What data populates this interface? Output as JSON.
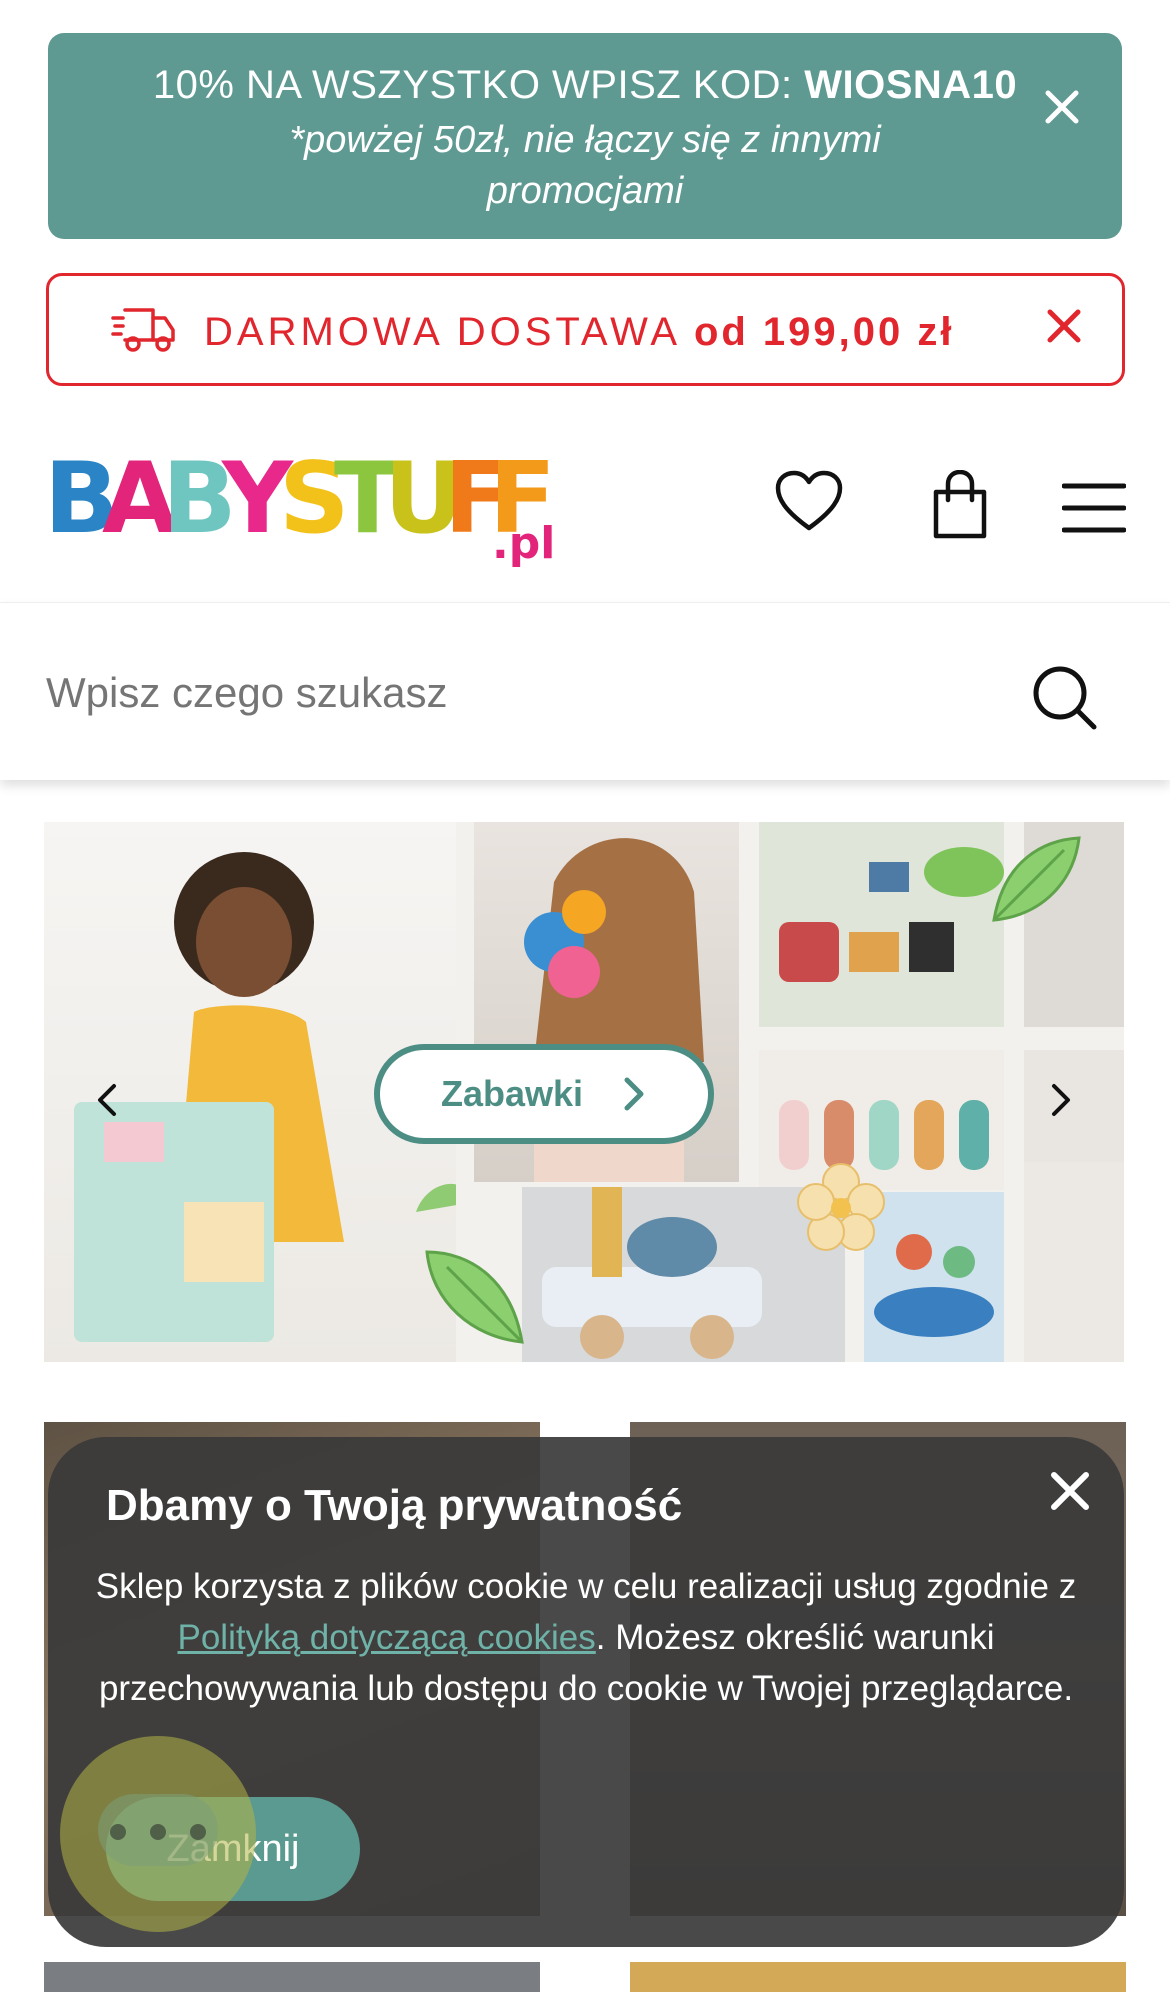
{
  "promo": {
    "text_prefix": "10% NA WSZYSTKO WPISZ KOD: ",
    "code": "WIOSNA10",
    "subtext": "*powżej 50zł, nie łączy się z innymi promocjami"
  },
  "delivery": {
    "label": "DARMOWA DOSTAWA ",
    "amount": "od 199,00 zł"
  },
  "logo": {
    "brand": "BABYSTUFF",
    "suffix": ".pl"
  },
  "search": {
    "placeholder": "Wpisz czego szukasz"
  },
  "hero": {
    "cta_label": "Zabawki"
  },
  "cookie": {
    "title": "Dbamy o Twoją prywatność",
    "text_before": "Sklep korzysta z plików cookie w celu realizacji usług zgodnie z ",
    "link_text": "Polityką dotyczącą cookies",
    "text_after": ". Możesz określić warunki przechowywania lub dostępu do cookie w Twojej przeglądarce.",
    "button_label": "Zamknij"
  },
  "colors": {
    "teal": "#5f9a92",
    "red": "#e1262d",
    "dark_teal": "#4c8d84"
  }
}
